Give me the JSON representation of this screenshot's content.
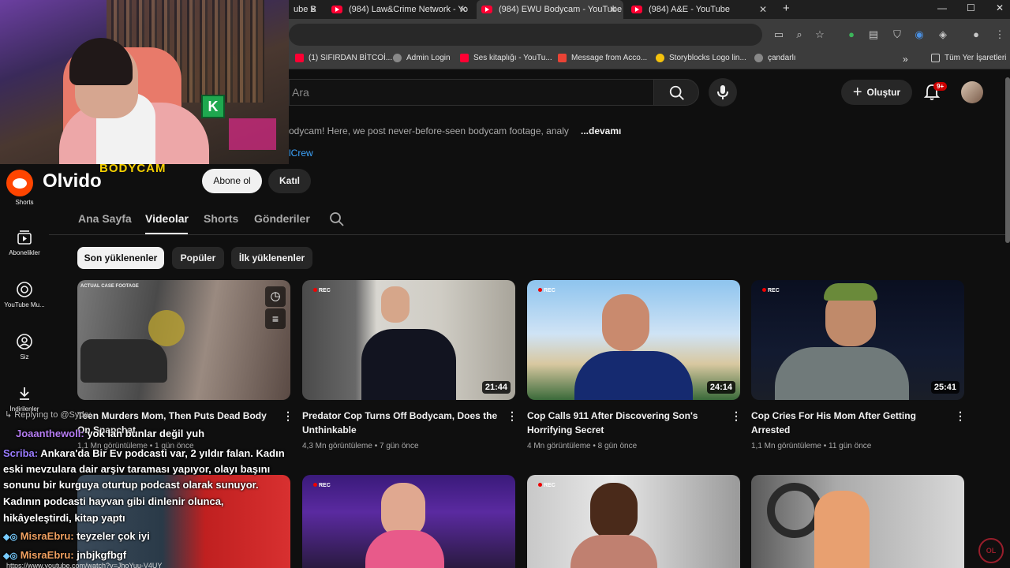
{
  "browser": {
    "tabs": [
      {
        "label": "ube Bodycam - YouTube",
        "active": false
      },
      {
        "label": "(984) Law&Crime Network - Yo",
        "active": false
      },
      {
        "label": "(984) EWU Bodycam - YouTube",
        "active": true
      },
      {
        "label": "(984) A&E - YouTube",
        "active": false
      }
    ],
    "bookmarks": [
      {
        "label": "(1) SIFIRDAN BİTCOİ...",
        "icon": "youtube-icon"
      },
      {
        "label": "Admin Login",
        "icon": "globe-icon"
      },
      {
        "label": "Ses kitaplığı - YouTu...",
        "icon": "youtube-icon"
      },
      {
        "label": "Message from Acco...",
        "icon": "gmail-icon"
      },
      {
        "label": "Storyblocks Logo lin...",
        "icon": "storyblocks-icon"
      },
      {
        "label": "çandarlı",
        "icon": "globe-icon"
      }
    ],
    "all_bookmarks_label": "Tüm Yer İşaretleri"
  },
  "youtube": {
    "search_placeholder": "Ara",
    "create_label": "Oluştur",
    "notif_badge": "9+",
    "description": "odycam! Here, we post never-before-seen bodycam footage, analy",
    "description_more": "...devamı",
    "link_text": "lCrew",
    "channel_name": "Olvido",
    "channel_logo_text": "BODYCAM",
    "subscribe_label": "Abone ol",
    "join_label": "Katıl",
    "tabs": [
      "Ana Sayfa",
      "Videolar",
      "Shorts",
      "Gönderiler"
    ],
    "active_tab": "Videolar",
    "chips": [
      "Son yüklenenler",
      "Popüler",
      "İlk yüklenenler"
    ],
    "nav": [
      {
        "label": "Shorts"
      },
      {
        "label": "Abonelikler"
      },
      {
        "label": "YouTube Mu..."
      },
      {
        "label": "Siz"
      },
      {
        "label": "İndirilenler"
      }
    ],
    "videos": [
      {
        "title": "Cop Calls 911 After Discovering Son's Horrifying Secret",
        "views": "4 Mn görüntüleme",
        "age": "8 gün önce",
        "duration": "24:14"
      },
      {
        "title": "Predator Cop Turns Off Bodycam, Does the Unthinkable",
        "views": "4,3 Mn görüntüleme",
        "age": "7 gün önce",
        "duration": "21:44"
      },
      {
        "title": "Cop Cries For His Mom After Getting Arrested",
        "views": "1,1 Mn görüntüleme",
        "age": "11 gün önce",
        "duration": "25:41"
      },
      {
        "title": "Teen Murders Mom, Then Puts Dead Body On Snapchat",
        "views": "1,1 Mn görüntüleme",
        "age": "1 gün önce",
        "duration": ""
      }
    ],
    "thumb_labels": {
      "actual_case": "ACTUAL CASE FOOTAGE",
      "rec": "REC"
    }
  },
  "chat": {
    "reply_line": "Replying to @Syde:",
    "messages": [
      {
        "user": "Joaanthewoll:",
        "text": "yok lan bunlar değil yuh"
      },
      {
        "user": "Scriba:",
        "text": "Ankara'da Bir Ev podcasti var, 2 yıldır falan. Kadın"
      },
      {
        "user": "",
        "text": "eski mevzulara dair arşiv taraması yapıyor, olayı başını"
      },
      {
        "user": "",
        "text": "sonunu bir kurguya oturtup podcast olarak sunuyor."
      },
      {
        "user": "",
        "text": "Kadının podcasti hayvan gibi dinlenir olunca,"
      },
      {
        "user": "",
        "text": "hikâyeleştirdi, kitap yaptı"
      },
      {
        "user": "MisraEbru:",
        "text": "teyzeler çok iyi"
      },
      {
        "user": "MisraEbru:",
        "text": "jnbjkgfbgf"
      }
    ],
    "url_line": "https://www.youtube.com/watch?v=JhoYuu-V4UY",
    "watermark": "OL"
  }
}
